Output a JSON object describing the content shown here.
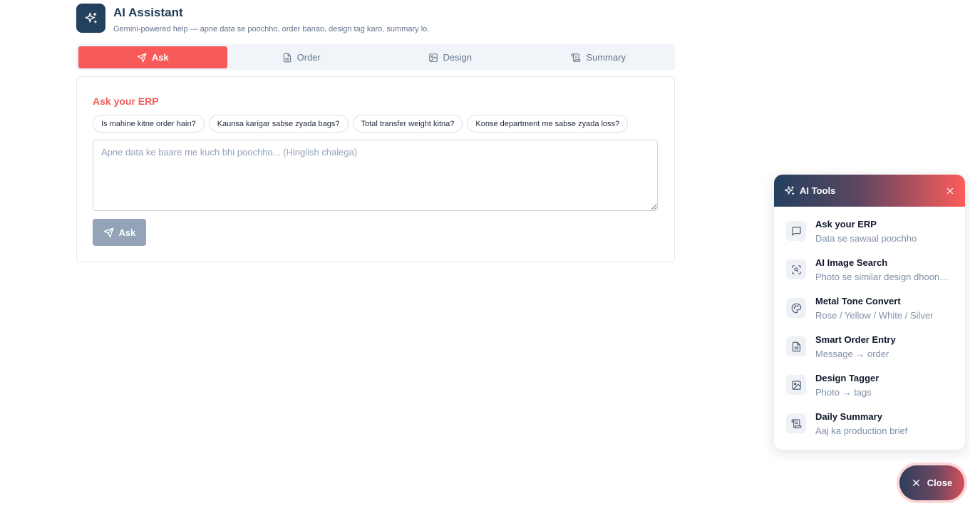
{
  "header": {
    "title": "AI Assistant",
    "subtitle": "Gemini-powered help — apne data se poochho, order banao, design tag karo, summary lo.",
    "logo_icon": "sparkles-icon"
  },
  "tabs": [
    {
      "label": "Ask",
      "icon": "send-icon",
      "active": true
    },
    {
      "label": "Order",
      "icon": "document-icon",
      "active": false
    },
    {
      "label": "Design",
      "icon": "image-icon",
      "active": false
    },
    {
      "label": "Summary",
      "icon": "scroll-icon",
      "active": false
    }
  ],
  "ask": {
    "title": "Ask your ERP",
    "suggestions": [
      "Is mahine kitne order hain?",
      "Kaunsa karigar sabse zyada bags?",
      "Total transfer weight kitna?",
      "Konse department me sabse zyada loss?"
    ],
    "placeholder": "Apne data ke baare me kuch bhi poochho... (Hinglish chalega)",
    "value": "",
    "button_label": "Ask",
    "button_disabled": true
  },
  "ai_tools": {
    "title": "AI Tools",
    "items": [
      {
        "name": "Ask your ERP",
        "desc": "Data se sawaal poochho",
        "icon": "chat-icon"
      },
      {
        "name": "AI Image Search",
        "desc": "Photo se similar design dhoondho",
        "icon": "scan-search-icon"
      },
      {
        "name": "Metal Tone Convert",
        "desc": "Rose / Yellow / White / Silver",
        "icon": "palette-icon"
      },
      {
        "name": "Smart Order Entry",
        "desc": "Message → order",
        "icon": "document-icon"
      },
      {
        "name": "Design Tagger",
        "desc": "Photo → tags",
        "icon": "image-icon"
      },
      {
        "name": "Daily Summary",
        "desc": "Aaj ka production brief",
        "icon": "scroll-icon"
      }
    ]
  },
  "fab": {
    "label": "Close",
    "icon": "close-icon"
  },
  "colors": {
    "accent": "#f85a5a",
    "navy": "#24405f",
    "muted": "#64748b",
    "disabled_button": "#94a3b8"
  }
}
